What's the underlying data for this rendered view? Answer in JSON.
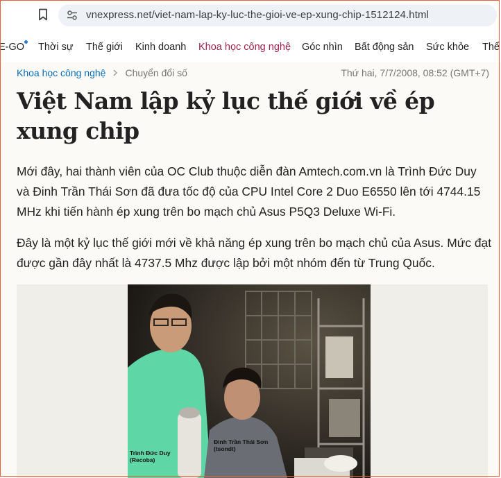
{
  "browser": {
    "url": "vnexpress.net/viet-nam-lap-ky-luc-the-gioi-ve-ep-xung-chip-1512124.html"
  },
  "nav": {
    "items": [
      "E-GO",
      "Thời sự",
      "Thế giới",
      "Kinh doanh",
      "Khoa học công nghệ",
      "Góc nhìn",
      "Bất động sản",
      "Sức khỏe",
      "Thể"
    ],
    "active_index": 4
  },
  "article": {
    "breadcrumb": [
      "Khoa học công nghệ",
      "Chuyển đổi số"
    ],
    "date": "Thứ hai, 7/7/2008, 08:52 (GMT+7)",
    "title": "Việt Nam lập kỷ lục thế giới về ép xung chip",
    "paragraphs": [
      "Mới đây, hai thành viên của OC Club thuộc diễn đàn Amtech.com.vn là Trình Đức Duy và Đinh Trần Thái Sơn đã đưa tốc độ của CPU Intel Core 2 Duo E6550 lên tới 4744.15 MHz khi tiến hành ép xung trên bo mạch chủ Asus P5Q3 Deluxe Wi-Fi.",
      "Đây là một kỷ lục thế giới mới về khả năng ép xung trên bo mạch chủ của Asus. Mức đạt được gần đây nhất là 4737.5 Mhz được lập bởi một nhóm đến từ Trung Quốc."
    ],
    "photo_captions": [
      [
        "Trình Đức Duy",
        "(Recoba)"
      ],
      [
        "Đinh Trần Thái Sơn",
        "(tsondt)"
      ]
    ]
  },
  "colors": {
    "accent": "#9f224e",
    "link": "#076db6",
    "frame": "#e8603a"
  }
}
